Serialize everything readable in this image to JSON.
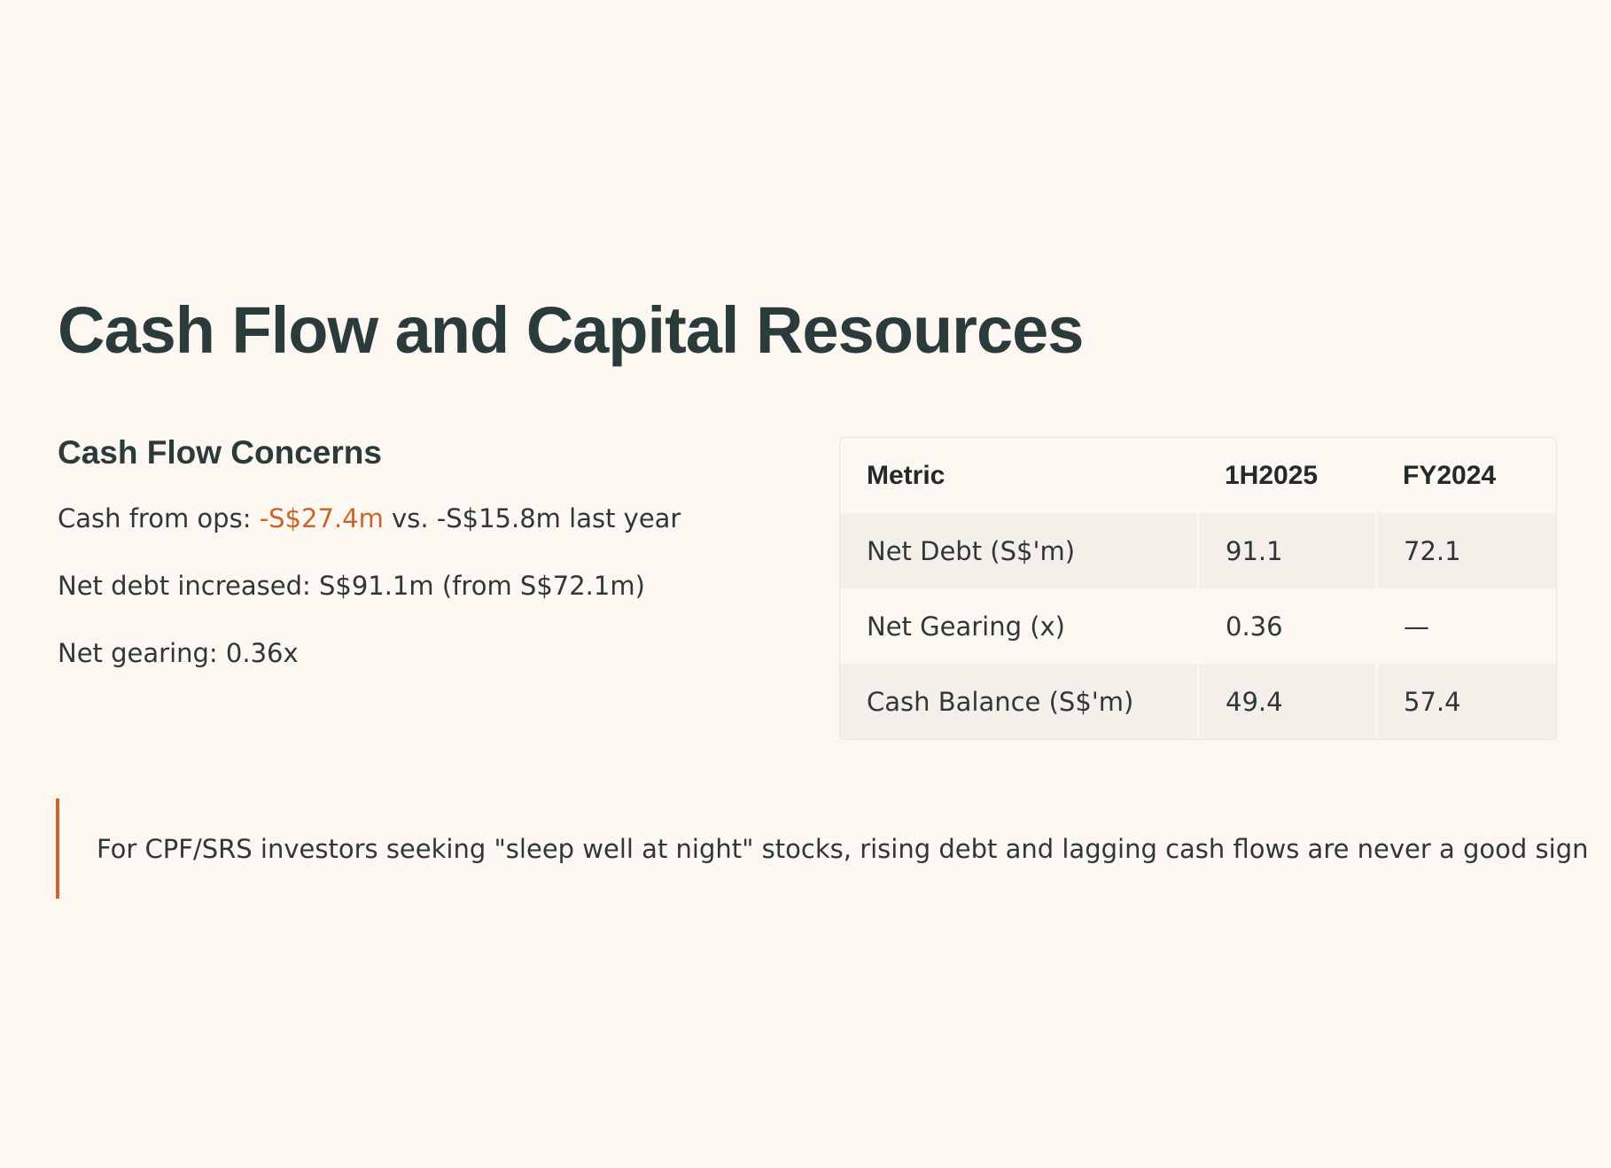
{
  "title": "Cash Flow and Capital Resources",
  "concerns": {
    "heading": "Cash Flow Concerns",
    "items": [
      {
        "label": "Cash from ops: ",
        "highlight": "-S$27.4m",
        "rest": " vs. -S$15.8m last year"
      },
      {
        "label": "Net debt increased: S$91.1m (from S$72.1m)"
      },
      {
        "label": "Net gearing: 0.36x"
      }
    ]
  },
  "table": {
    "headers": [
      "Metric",
      "1H2025",
      "FY2024"
    ],
    "rows": [
      [
        "Net Debt (S$'m)",
        "91.1",
        "72.1"
      ],
      [
        "Net Gearing (x)",
        "0.36",
        "—"
      ],
      [
        "Cash Balance (S$'m)",
        "49.4",
        "57.4"
      ]
    ]
  },
  "quote": "For CPF/SRS investors seeking \"sleep well at night\" stocks, rising debt and lagging cash flows are never a good sign",
  "colors": {
    "accent": "#c9672a",
    "background": "#fdf7f1",
    "text": "#2b3b3c"
  }
}
